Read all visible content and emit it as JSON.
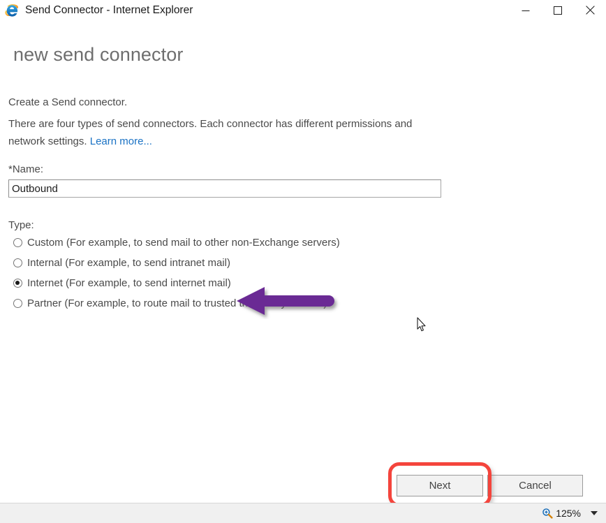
{
  "window": {
    "title": "Send Connector - Internet Explorer",
    "app_icon": "internet-explorer-icon",
    "controls": {
      "minimize": "minimize-icon",
      "maximize": "maximize-icon",
      "close": "close-icon"
    }
  },
  "page": {
    "heading": "new send connector",
    "intro_line1": "Create a Send connector.",
    "intro_line2": "There are four types of send connectors. Each connector has different permissions and network settings.",
    "learn_more_label": "Learn more...",
    "name": {
      "label": "*Name:",
      "value": "Outbound",
      "placeholder": ""
    },
    "type": {
      "label": "Type:",
      "options": [
        {
          "label": "Custom (For example, to send mail to other non-Exchange servers)",
          "selected": false
        },
        {
          "label": "Internal (For example, to send intranet mail)",
          "selected": false
        },
        {
          "label": "Internet (For example, to send internet mail)",
          "selected": true
        },
        {
          "label": "Partner (For example, to route mail to trusted third-party servers)",
          "selected": false
        }
      ]
    }
  },
  "footer": {
    "next_label": "Next",
    "cancel_label": "Cancel"
  },
  "statusbar": {
    "zoom_icon": "zoom-in-magnifier-icon",
    "zoom_level": "125%",
    "zoom_caret": "chevron-down-icon"
  },
  "annotations": {
    "arrow_color": "#6b2a94",
    "highlight_color": "#f4443c",
    "arrow_target": "Internet (For example, to send internet mail)",
    "highlight_target": "Next"
  },
  "colors": {
    "link": "#1a72c4",
    "text": "#4a4a4a",
    "heading": "#6e6e6e",
    "statusbar_bg": "#f0f0f0"
  }
}
